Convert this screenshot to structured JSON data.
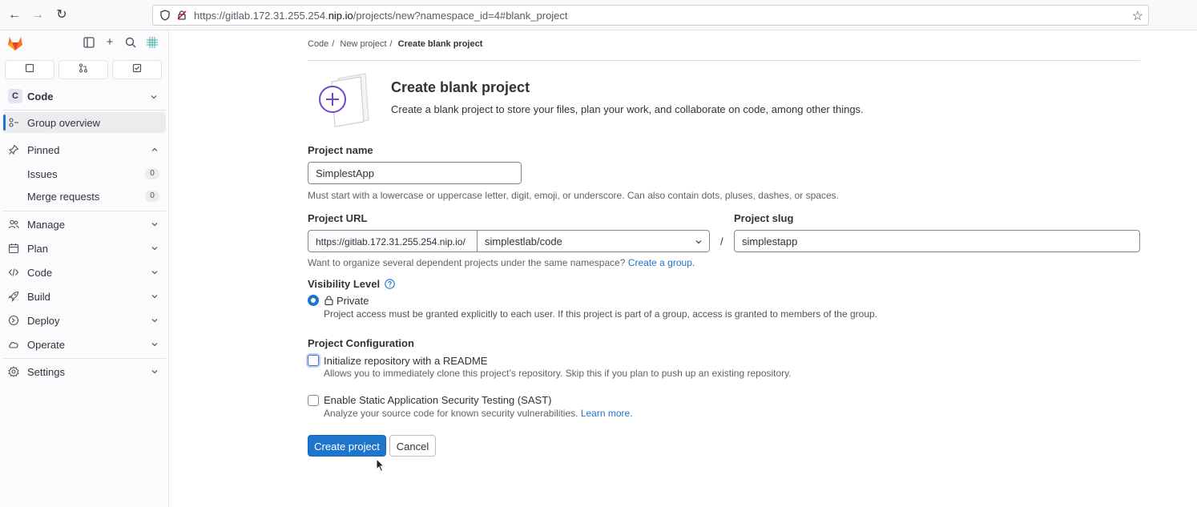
{
  "browser": {
    "url_prefix": "https://gitlab.172.31.255.254.",
    "url_domain": "nip.io",
    "url_path": "/projects/new?namespace_id=4#blank_project"
  },
  "sidebar": {
    "context": {
      "avatar_letter": "C",
      "label": "Code"
    },
    "group_overview": "Group overview",
    "pinned": {
      "label": "Pinned",
      "items": [
        {
          "label": "Issues",
          "count": "0"
        },
        {
          "label": "Merge requests",
          "count": "0"
        }
      ]
    },
    "items": [
      {
        "label": "Manage",
        "icon": "users-icon"
      },
      {
        "label": "Plan",
        "icon": "calendar-icon"
      },
      {
        "label": "Code",
        "icon": "code-icon"
      },
      {
        "label": "Build",
        "icon": "rocket-icon"
      },
      {
        "label": "Deploy",
        "icon": "deploy-icon"
      },
      {
        "label": "Operate",
        "icon": "cloud-icon"
      }
    ],
    "settings": "Settings"
  },
  "breadcrumb": [
    "Code",
    "New project",
    "Create blank project"
  ],
  "header": {
    "title": "Create blank project",
    "subtitle": "Create a blank project to store your files, plan your work, and collaborate on code, among other things."
  },
  "form": {
    "project_name": {
      "label": "Project name",
      "value": "SimplestApp",
      "help": "Must start with a lowercase or uppercase letter, digit, emoji, or underscore. Can also contain dots, pluses, dashes, or spaces."
    },
    "project_url": {
      "label": "Project URL",
      "prefix": "https://gitlab.172.31.255.254.nip.io/",
      "namespace": "simplestlab/code",
      "separator": "/",
      "help": "Want to organize several dependent projects under the same namespace?",
      "help_link": "Create a group."
    },
    "project_slug": {
      "label": "Project slug",
      "value": "simplestapp"
    },
    "visibility": {
      "label": "Visibility Level",
      "option": "Private",
      "description": "Project access must be granted explicitly to each user. If this project is part of a group, access is granted to members of the group."
    },
    "configuration": {
      "label": "Project Configuration",
      "readme": {
        "label": "Initialize repository with a README",
        "help": "Allows you to immediately clone this project’s repository. Skip this if you plan to push up an existing repository.",
        "checked": false
      },
      "sast": {
        "label": "Enable Static Application Security Testing (SAST)",
        "help": "Analyze your source code for known security vulnerabilities.",
        "help_link": "Learn more.",
        "checked": false
      }
    },
    "buttons": {
      "create": "Create project",
      "cancel": "Cancel"
    }
  },
  "colors": {
    "accent": "#1f75cb",
    "logo_orange": "#e24329"
  }
}
